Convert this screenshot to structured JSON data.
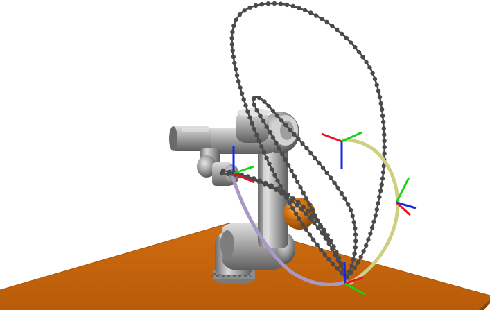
{
  "scene": {
    "colors": {
      "background": "#ffffff",
      "table_top": "#c8650c",
      "table_edge": "#8a4506",
      "robot_light": "#c9c9c9",
      "robot_mid": "#9a9a9a",
      "robot_dark": "#5c5c5c",
      "trajectory_dotted": "#4a4a4a",
      "trajectory_lavender": "#a898c4",
      "trajectory_khaki": "#cfcf82",
      "sphere": "#d6720e",
      "axis_x": "#e8141e",
      "axis_y": "#16d416",
      "axis_z": "#1626e6"
    }
  }
}
